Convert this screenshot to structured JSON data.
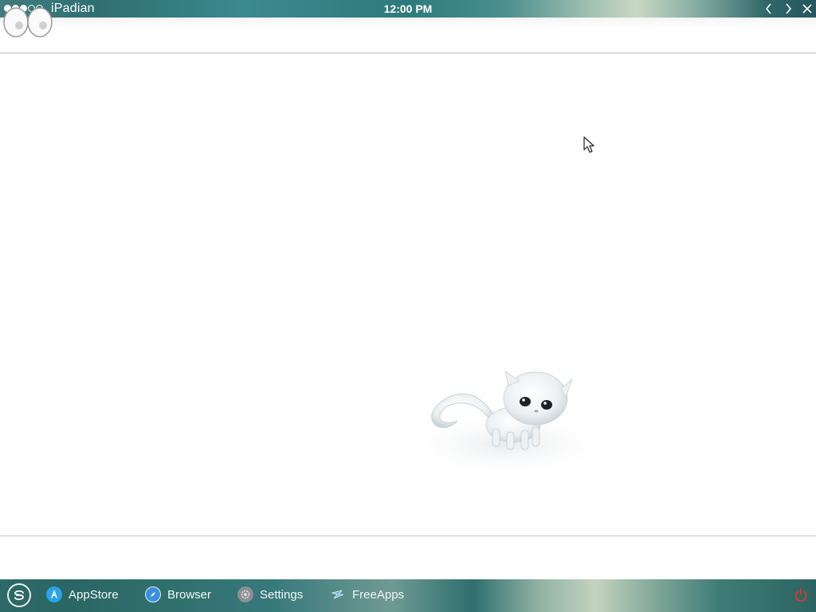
{
  "status_bar": {
    "carrier": "iPadian",
    "time": "12:00 PM",
    "signal": {
      "filled": 3,
      "total": 5
    }
  },
  "window_controls": [
    "back-icon",
    "forward-icon",
    "close-icon"
  ],
  "dock": {
    "items": [
      {
        "label": "AppStore",
        "icon": "appstore-icon"
      },
      {
        "label": "Browser",
        "icon": "compass-icon"
      },
      {
        "label": "Settings",
        "icon": "gear-icon"
      },
      {
        "label": "FreeApps",
        "icon": "freeapps-icon"
      }
    ],
    "start_icon": "ipadian-logo-icon",
    "power_icon": "power-icon"
  },
  "colors": {
    "statusbar": "#2f6f72",
    "dock": "#2d6a67",
    "power": "#e03a2f",
    "appstore": "#2aa3e8",
    "browser": "#3a8fe0",
    "settings": "#8c8f92",
    "freeapps": "#6fb7d6"
  }
}
